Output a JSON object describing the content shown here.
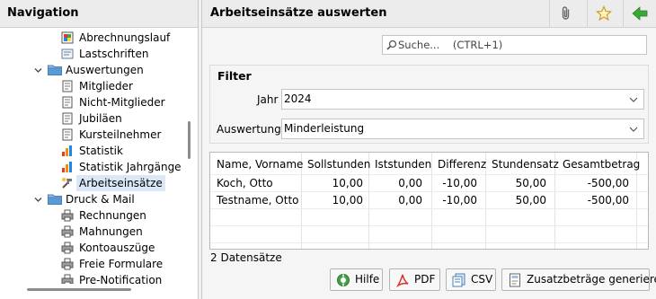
{
  "nav": {
    "title": "Navigation",
    "items": [
      {
        "label": "Abrechnungslauf",
        "icon": "bill-run-icon"
      },
      {
        "label": "Lastschriften",
        "icon": "debit-icon"
      },
      {
        "label": "Auswertungen",
        "icon": "folder-icon",
        "expanded": true
      },
      {
        "label": "Mitglieder",
        "icon": "report-icon"
      },
      {
        "label": "Nicht-Mitglieder",
        "icon": "report-icon"
      },
      {
        "label": "Jubiläen",
        "icon": "report-icon"
      },
      {
        "label": "Kursteilnehmer",
        "icon": "report-icon"
      },
      {
        "label": "Statistik",
        "icon": "bar-chart-icon"
      },
      {
        "label": "Statistik Jahrgänge",
        "icon": "bar-chart-icon"
      },
      {
        "label": "Arbeitseinsätze",
        "icon": "work-icon",
        "selected": true
      },
      {
        "label": "Druck & Mail",
        "icon": "folder-icon",
        "expanded": true
      },
      {
        "label": "Rechnungen",
        "icon": "printer-icon"
      },
      {
        "label": "Mahnungen",
        "icon": "printer-icon"
      },
      {
        "label": "Kontoauszüge",
        "icon": "printer-icon"
      },
      {
        "label": "Freie Formulare",
        "icon": "printer-icon"
      },
      {
        "label": "Pre-Notification",
        "icon": "printer-icon"
      }
    ]
  },
  "main": {
    "title": "Arbeitseinsätze auswerten",
    "header_buttons": [
      "paperclip-icon",
      "star-icon",
      "back-arrow-icon"
    ],
    "search_placeholder": "Suche...    (CTRL+1)",
    "filter": {
      "title": "Filter",
      "jahr_label": "Jahr",
      "jahr_value": "2024",
      "auswertung_label": "Auswertung",
      "auswertung_value": "Minderleistung"
    },
    "table": {
      "columns": [
        "Name, Vorname",
        "Sollstunden",
        "Iststunden",
        "Differenz",
        "Stundensatz",
        "Gesamtbetrag"
      ],
      "rows": [
        [
          "Koch, Otto",
          "10,00",
          "0,00",
          "-10,00",
          "50,00",
          "-500,00"
        ],
        [
          "Testname, Otto",
          "10,00",
          "0,00",
          "-10,00",
          "50,00",
          "-500,00"
        ]
      ]
    },
    "record_count": "2 Datensätze",
    "buttons": {
      "hilfe": "Hilfe",
      "pdf": "PDF",
      "csv": "CSV",
      "zusatz": "Zusatzbeträge generieren"
    }
  },
  "colors": {
    "accent_green": "#3aa835",
    "selected_bg": "#d9e7f7",
    "pdf_red": "#d9302a",
    "folder_blue": "#5b9bd5"
  }
}
